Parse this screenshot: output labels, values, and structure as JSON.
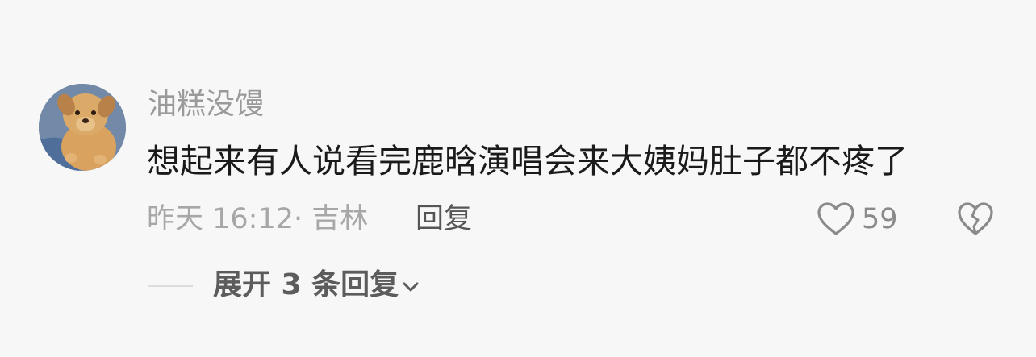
{
  "comment": {
    "username": "油糕没馒",
    "text": "想起来有人说看完鹿晗演唱会来大姨妈肚子都不疼了",
    "time": "昨天 16:12·",
    "location": "吉林",
    "reply_label": "回复",
    "like_count": "59",
    "expand_label": "展开 3 条回复"
  },
  "icons": {
    "like": "heart-outline-icon",
    "dislike": "broken-heart-icon",
    "expand": "chevron-down-icon"
  }
}
